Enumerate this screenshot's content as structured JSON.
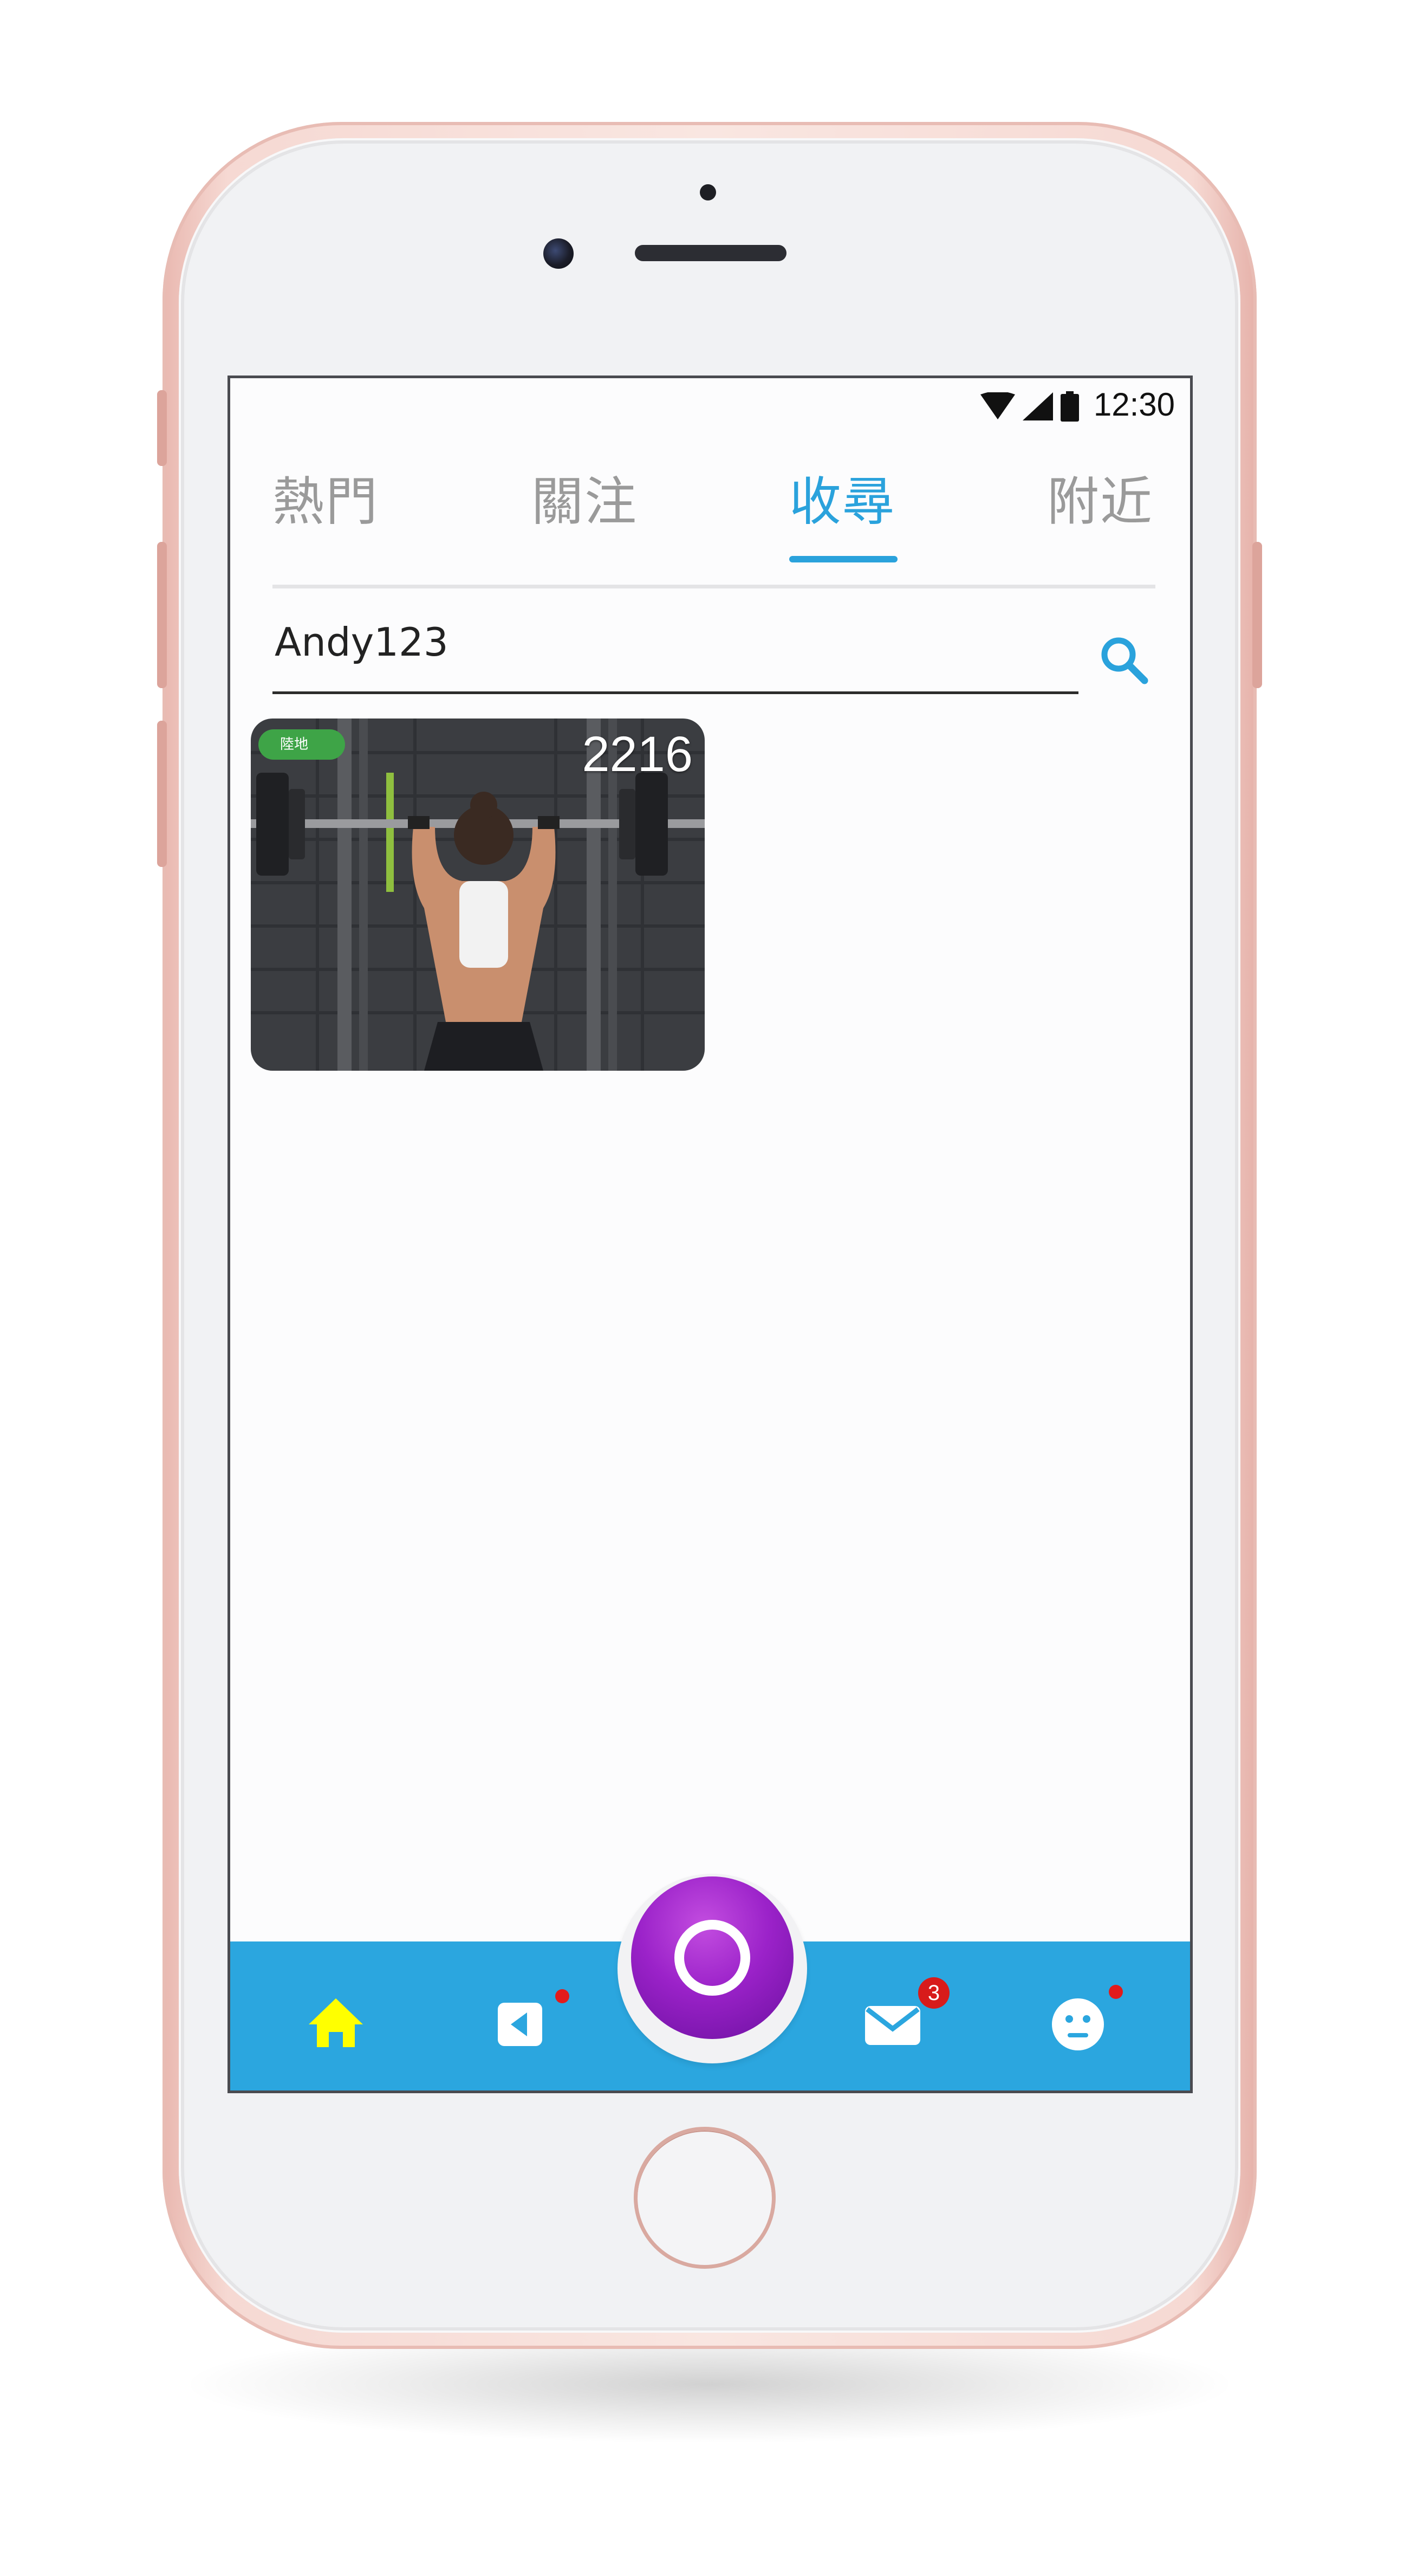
{
  "status_bar": {
    "time": "12:30",
    "icons": [
      "wifi-icon",
      "signal-icon",
      "battery-icon"
    ]
  },
  "tabs": [
    {
      "label": "熱門",
      "active": false
    },
    {
      "label": "關注",
      "active": false
    },
    {
      "label": "收尋",
      "active": true
    },
    {
      "label": "附近",
      "active": false
    }
  ],
  "search": {
    "value": "Andy123",
    "icon": "search-icon"
  },
  "results": [
    {
      "badge": "陸地",
      "count": "2216",
      "image": "weightlifting-photo"
    }
  ],
  "bottom_nav": {
    "items": [
      {
        "icon": "home-icon",
        "active": true
      },
      {
        "icon": "video-icon",
        "has_dot": true
      },
      {
        "icon": "record-icon"
      },
      {
        "icon": "mail-icon",
        "badge": "3"
      },
      {
        "icon": "profile-icon",
        "has_dot": true
      }
    ]
  },
  "colors": {
    "accent": "#2aa2dc",
    "nav_bg": "#2ba6df",
    "home_active": "#ffff00",
    "fab": "#9b22c9",
    "badge_green": "#3ea447",
    "notification_red": "#e21b1b"
  }
}
